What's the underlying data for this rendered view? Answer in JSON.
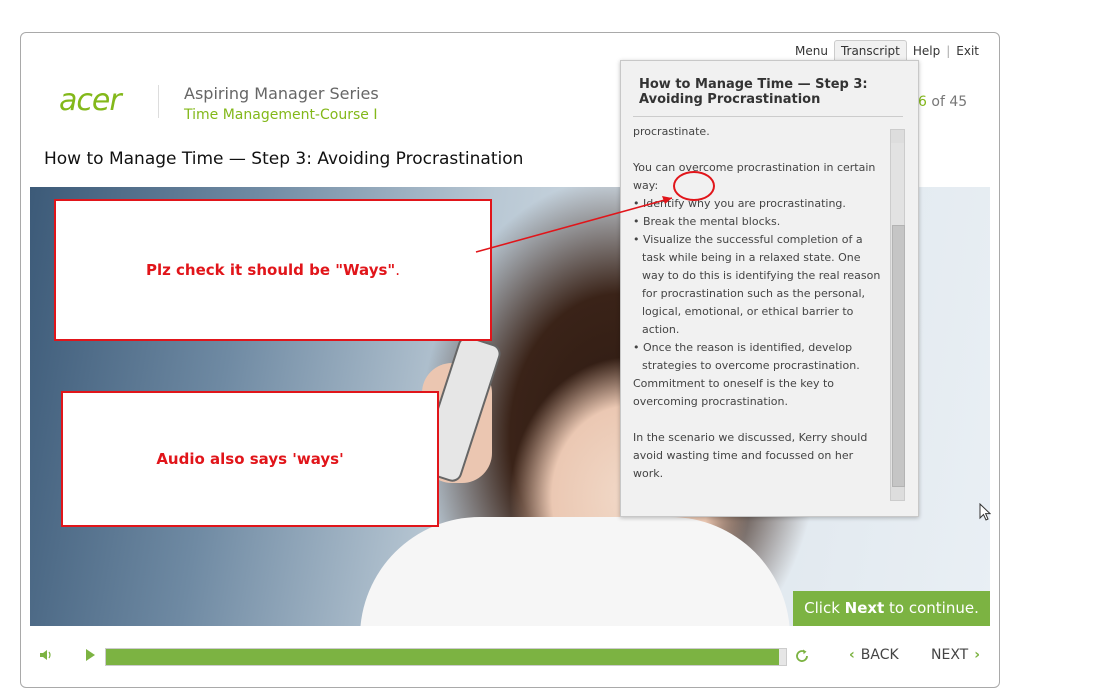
{
  "topnav": {
    "menu": "Menu",
    "transcript": "Transcript",
    "help": "Help",
    "separator": "|",
    "exit": "Exit"
  },
  "logo": {
    "text": "acer"
  },
  "header": {
    "series": "Aspiring Manager Series",
    "course": "Time Management-Course I"
  },
  "page": {
    "current": "6",
    "of": " of 45"
  },
  "slide": {
    "title": "How to Manage Time — Step 3: Avoiding Procrastination"
  },
  "annotations": {
    "note1_main": "Plz check it should be \"Ways\"",
    "note1_tail": ".",
    "note2": "Audio also says 'ways'"
  },
  "clicknext": {
    "prefix": "Click ",
    "bold": "Next",
    "suffix": " to continue."
  },
  "controls": {
    "back": "BACK",
    "next": "NEXT",
    "progress_fraction": 0.99
  },
  "transcript": {
    "title": "How to Manage Time — Step 3: Avoiding Procrastination",
    "line_intro": "procrastinate.",
    "para1": "You can overcome procrastination in certain way:",
    "bullets": [
      "• Identify why you are procrastinating.",
      "• Break the mental blocks.",
      "• Visualize the successful completion of a task while being in a relaxed state. One way to do this is identifying the real reason for procrastination such as the personal, logical, emotional, or ethical barrier to action.",
      "• Once the reason is identified, develop strategies to overcome procrastination."
    ],
    "para2": "Commitment to oneself is the key to overcoming procrastination.",
    "para3": "In the scenario we discussed, Kerry should avoid wasting time and focussed on her work."
  },
  "icons": {
    "mute": "speaker-icon",
    "play": "play-icon",
    "replay": "replay-icon",
    "back": "chevron-left-icon",
    "next": "chevron-right-icon"
  },
  "colors": {
    "brand": "#83b81a",
    "accent": "#7cb342",
    "annotation": "#e1151a"
  }
}
